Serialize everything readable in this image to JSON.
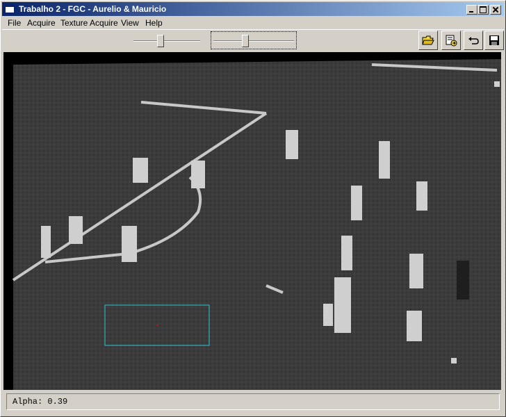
{
  "window": {
    "title": "Trabalho 2 - FGC - Aurelio & Mauricio"
  },
  "menu": [
    "File",
    "Acquire",
    "Texture Acquire",
    "View",
    "Help"
  ],
  "toolbar": {
    "slider1_value": 0.4,
    "slider2_value": 0.39,
    "tools": [
      "open-folder-icon",
      "save-icon",
      "undo-icon",
      "disk-icon"
    ]
  },
  "status": {
    "text": "Alpha: 0.39"
  },
  "colors": {
    "selection_box": "#27c7d6",
    "marker": "#d01010",
    "titlebar_start": "#0a246a",
    "titlebar_end": "#a6caf0"
  }
}
